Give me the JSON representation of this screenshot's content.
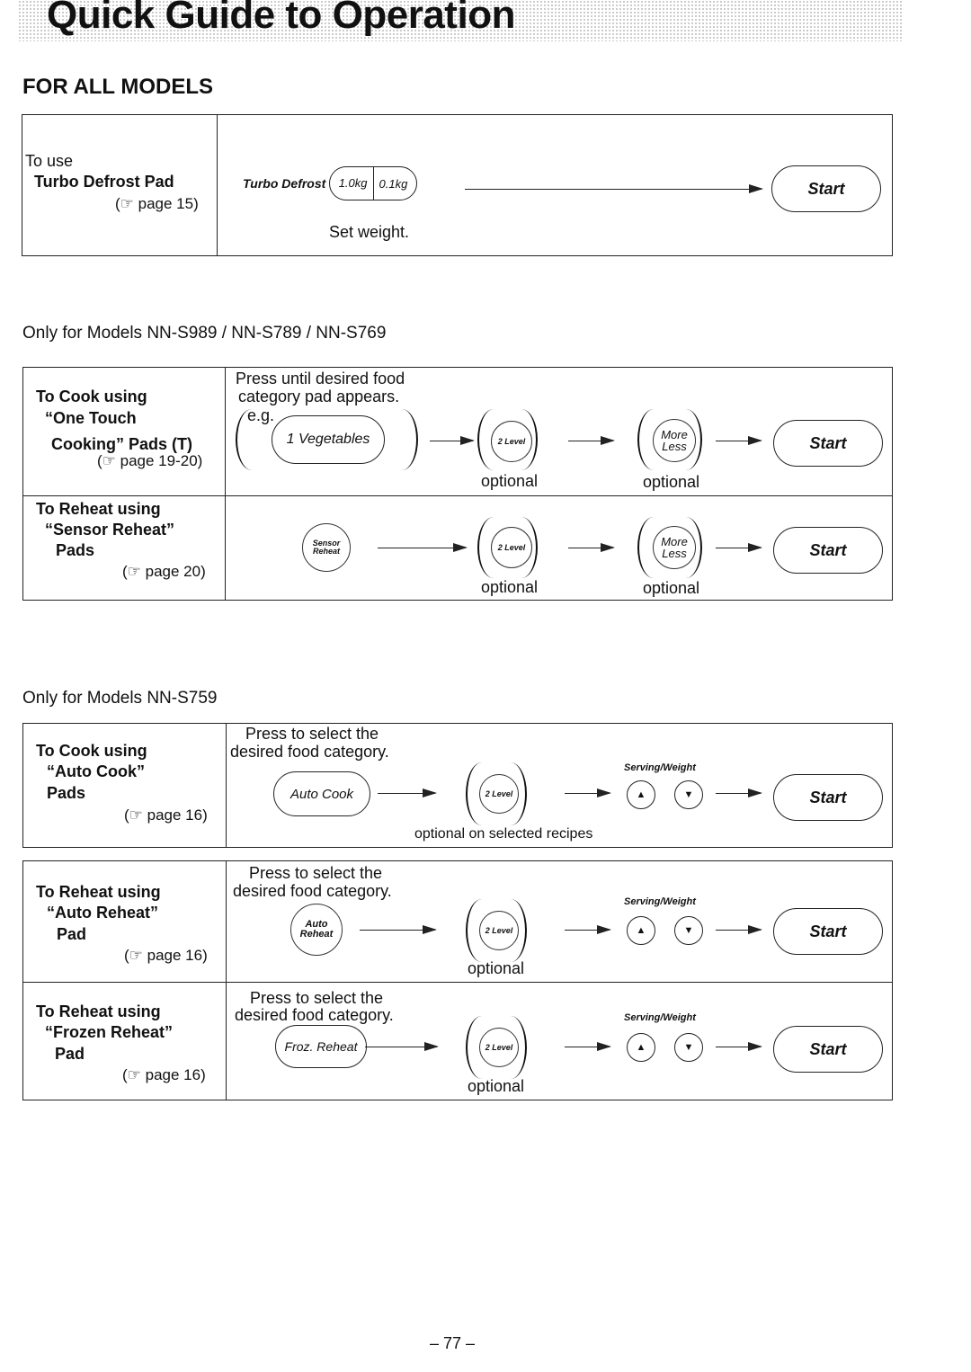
{
  "title": "Quick Guide to Operation",
  "section_all": {
    "heading": "FOR ALL MODELS",
    "turbo": {
      "l1": "To use",
      "l2": "Turbo Defrost Pad",
      "page": "(☞ page 15)",
      "pad_label": "Turbo Defrost",
      "seg1": "1.0kg",
      "seg2": "0.1kg",
      "start": "Start",
      "note": "Set weight."
    }
  },
  "section_s989": {
    "heading": "Only for Models NN-S989 / NN-S789 / NN-S769",
    "one_touch": {
      "l1": "To Cook using",
      "l2": "“One Touch",
      "l3": "Cooking” Pads (T)",
      "page": "(☞ page 19-20)",
      "instr1": "Press until desired food",
      "instr2": "category pad appears.",
      "eg": "e.g.",
      "pad": "1  Vegetables",
      "level": "2 Level",
      "more": "More",
      "less": "Less",
      "optional": "optional",
      "start": "Start"
    },
    "sensor": {
      "l1": "To Reheat using",
      "l2": "“Sensor Reheat”",
      "l3": "Pads",
      "page": "(☞ page 20)",
      "pad1": "Sensor",
      "pad2": "Reheat",
      "level": "2 Level",
      "more": "More",
      "less": "Less",
      "optional": "optional",
      "start": "Start"
    }
  },
  "section_s759": {
    "heading": "Only for Models NN-S759",
    "auto_cook": {
      "l1": "To Cook using",
      "l2": "“Auto Cook”",
      "l3": "Pads",
      "page": "(☞ page 16)",
      "instr1": "Press to select the",
      "instr2": "desired food category.",
      "pad": "Auto Cook",
      "level": "2 Level",
      "serving": "Serving/Weight",
      "up": "▲",
      "down": "▼",
      "note": "optional on selected recipes",
      "start": "Start"
    },
    "auto_reheat": {
      "l1": "To Reheat using",
      "l2": "“Auto Reheat”",
      "l3": "Pad",
      "page": "(☞ page 16)",
      "instr1": "Press to select the",
      "instr2": "desired food category.",
      "pad1": "Auto",
      "pad2": "Reheat",
      "level": "2 Level",
      "serving": "Serving/Weight",
      "up": "▲",
      "down": "▼",
      "note": "optional",
      "start": "Start"
    },
    "frozen": {
      "l1": "To Reheat using",
      "l2": "“Frozen Reheat”",
      "l3": "Pad",
      "page": "(☞ page 16)",
      "instr1": "Press to select the",
      "instr2": "desired food category.",
      "pad": "Froz. Reheat",
      "level": "2 Level",
      "serving": "Serving/Weight",
      "up": "▲",
      "down": "▼",
      "note": "optional",
      "start": "Start"
    }
  },
  "page_number": "– 77 –"
}
